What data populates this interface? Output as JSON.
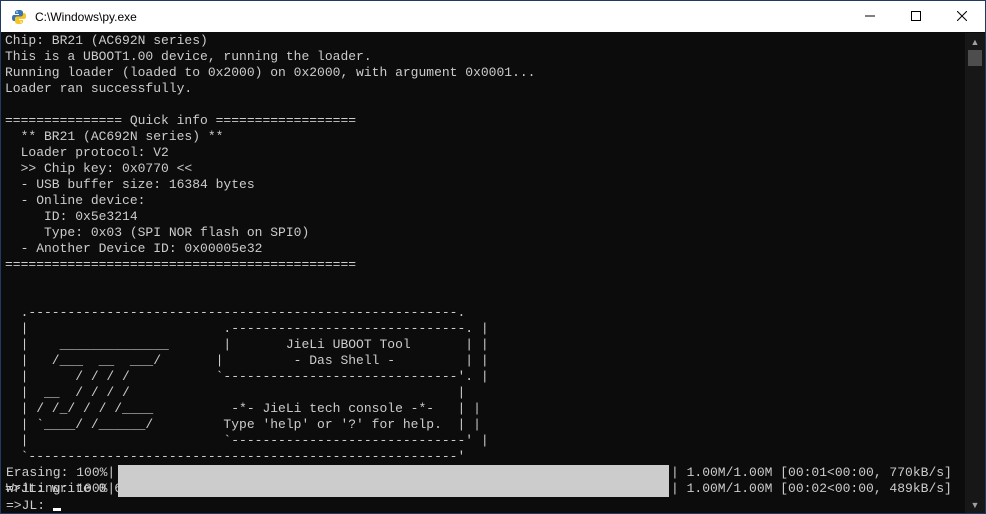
{
  "window": {
    "title": "C:\\Windows\\py.exe",
    "icon": "python-icon",
    "controls": {
      "minimize": "minimize-icon",
      "maximize": "maximize-icon",
      "close": "close-icon"
    }
  },
  "console": {
    "lines": [
      "Chip: BR21 (AC692N series)",
      "This is a UBOOT1.00 device, running the loader.",
      "Running loader (loaded to 0x2000) on 0x2000, with argument 0x0001...",
      "Loader ran successfully.",
      "",
      "=============== Quick info ==================",
      "  ** BR21 (AC692N series) **",
      "  Loader protocol: V2",
      "  >> Chip key: 0x0770 <<",
      "  - USB buffer size: 16384 bytes",
      "  - Online device:",
      "     ID: 0x5e3214",
      "     Type: 0x03 (SPI NOR flash on SPI0)",
      "  - Another Device ID: 0x00005e32",
      "=============================================",
      "",
      "",
      "  .-------------------------------------------------------.",
      "  |                         .------------------------------. |",
      "  |    ______________       |       JieLi UBOOT Tool       | |",
      "  |   /___  __  ___/       |         - Das Shell -         | |",
      "  |      / / / /           `------------------------------'. |",
      "  |  __  / / / /                                          |",
      "  | / /_/ / / /____          -*- JieLi tech console -*-   | |",
      "  | `____/ /______/         Type 'help' or '?' for help.  | |",
      "  |                         `------------------------------' |",
      "  `-------------------------------------------------------'",
      "",
      "=>JL: write 0 6921.bin"
    ],
    "progress": [
      {
        "label": "Erasing: 100%|",
        "percent": 100,
        "stats": "| 1.00M/1.00M [00:01<00:00, 770kB/s]"
      },
      {
        "label": "Writing: 100%|",
        "percent": 100,
        "stats": "| 1.00M/1.00M [00:02<00:00, 489kB/s]"
      }
    ],
    "prompt": "=>JL: "
  },
  "colors": {
    "background": "#0c0c0c",
    "text": "#cccccc",
    "progress_fill": "#cccccc",
    "titlebar": "#ffffff"
  }
}
